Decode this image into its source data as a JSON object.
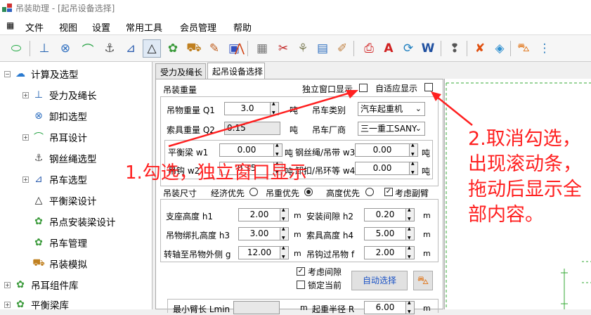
{
  "window": {
    "title": "吊装助理 - [起吊设备选择]"
  },
  "menu": [
    "文件",
    "视图",
    "设置",
    "常用工具",
    "会员管理",
    "帮助"
  ],
  "tree": {
    "items": [
      {
        "label": "计算及选型",
        "level": 0
      },
      {
        "label": "受力及绳长",
        "level": 1
      },
      {
        "label": "卸扣选型",
        "level": 1
      },
      {
        "label": "吊耳设计",
        "level": 1
      },
      {
        "label": "钢丝绳选型",
        "level": 1
      },
      {
        "label": "吊车选型",
        "level": 1
      },
      {
        "label": "平衡梁设计",
        "level": 1
      },
      {
        "label": "吊点安装梁设计",
        "level": 1
      },
      {
        "label": "吊车管理",
        "level": 1
      },
      {
        "label": "吊装模拟",
        "level": 1
      },
      {
        "label": "吊耳组件库",
        "level": 0
      },
      {
        "label": "平衡梁库",
        "level": 0
      }
    ]
  },
  "tabs": [
    "受力及绳长",
    "起吊设备选择"
  ],
  "form": {
    "section_weight": "吊装重量",
    "independent_window": "独立窗口显示",
    "adaptive_display": "自适应显示",
    "object_weight_label": "吊物重量 Q1",
    "object_weight_value": "3.0",
    "rig_weight_label": "索具重量 Q2",
    "rig_weight_value": "0.15",
    "unit_ton": "吨",
    "crane_type_label": "吊车类别",
    "crane_type_value": "汽车起重机",
    "crane_maker_label": "吊车厂商",
    "crane_maker_value": "三一重工SANY",
    "beam_label": "平衡梁 w1",
    "beam_value": "0.00",
    "rope_label": "钢丝绳/吊带 w3",
    "rope_value": "0.00",
    "hook_label": "吊钩 w2",
    "hook_value": "0.15",
    "ring_label": "卸扣/吊环等 w4",
    "ring_value": "0.00",
    "section_size": "吊装尺寸",
    "opt_economy": "经济优先",
    "opt_weight": "吊重优先",
    "opt_height": "高度优先",
    "consider_jib": "考虑副臂",
    "support_h_label": "支座高度 h1",
    "support_h_value": "2.00",
    "install_gap_label": "安装间隙 h2",
    "install_gap_value": "0.20",
    "bind_h_label": "吊物绑扎高度 h3",
    "bind_h_value": "3.00",
    "rig_h_label": "索具高度 h4",
    "rig_h_value": "5.00",
    "axis_dist_label": "转轴至吊物外侧 g",
    "axis_dist_value": "12.00",
    "hook_over_label": "吊钩过吊物 f",
    "hook_over_value": "2.00",
    "unit_m": "m",
    "consider_gap": "考虑间隙",
    "lock_current": "锁定当前",
    "auto_select": "自动选择",
    "min_boom_label": "最小臂长 Lmin",
    "lift_radius_label": "起重半径 R",
    "lift_radius_value": "6.00"
  },
  "annotations": {
    "note1": "1.勾选，独立窗口显示",
    "note2": "2.取消勾选，出现滚动条，拖动后显示全部内容。"
  },
  "colors": {
    "annotation": "#ff2020",
    "button_text": "#1a52c5"
  }
}
